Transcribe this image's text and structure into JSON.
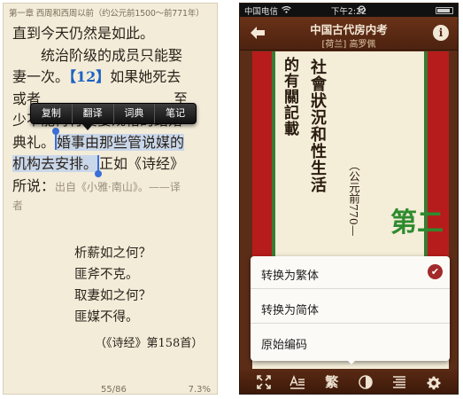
{
  "left": {
    "header": "第一章 西周和西周以前（约公元前1500～前771年）",
    "lines": {
      "l1": "直到今天仍然是如此。",
      "l2": "统治阶级的成员只能娶",
      "l3a": "妻一次。",
      "l3ref": "【12】",
      "l3b": "如果她死去",
      "l4a": "或者",
      "l4b": "至",
      "l5a": "少不能再行娶妻规格的",
      "l5b": "结婚",
      "l6a": "典礼。",
      "l6b": "婚事由那些管说媒的",
      "l7a": "机构去安排。",
      "l7b": "正如《诗经》",
      "l8a": "所说：",
      "l8note": "出自《小雅·南山》。——译",
      "l9note": "者"
    },
    "popup": [
      "复制",
      "翻译",
      "词典",
      "笔记"
    ],
    "poem": [
      "析薪如之何？",
      "匪斧不克。",
      "取妻如之何？",
      "匪媒不得。"
    ],
    "poem_source": "（《诗经》第158首）",
    "page": "55/86",
    "progress": "7.3%"
  },
  "right": {
    "status": {
      "carrier": "中国电信",
      "time": "下午2:22"
    },
    "nav": {
      "title": "中国古代房内考",
      "subtitle": "[荷兰] 高罗佩",
      "info": "i"
    },
    "page_text": {
      "col1": "的有關記載",
      "col2": "社會狀況和性生活",
      "col3": "（公元前770—",
      "big": "第二"
    },
    "menu": [
      {
        "label": "转换为繁体",
        "checked": true
      },
      {
        "label": "转换为简体",
        "checked": false
      },
      {
        "label": "原始编码",
        "checked": false
      }
    ],
    "toolbar": {
      "fan": "繁"
    },
    "colors": {
      "brown": "#5b2d17",
      "red": "#b71c1c",
      "green": "#3b7a34",
      "check": "#a22a2a"
    }
  }
}
